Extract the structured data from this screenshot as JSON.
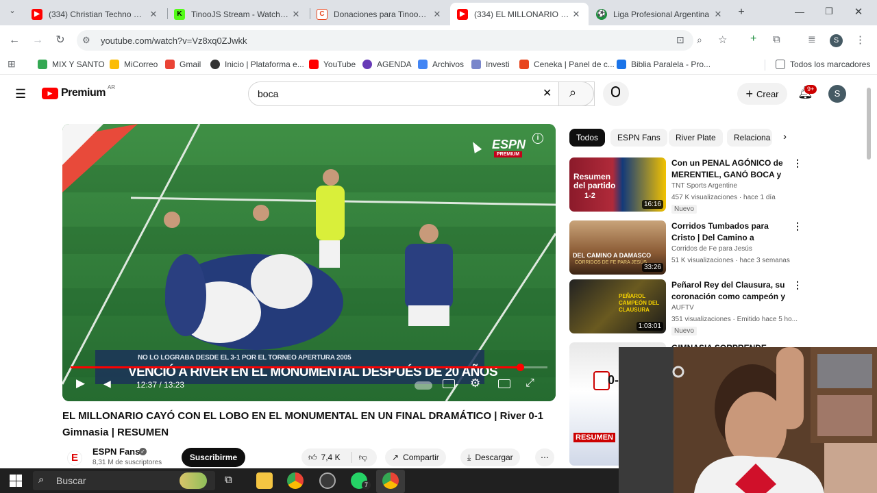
{
  "browser": {
    "tabs": [
      {
        "title": "(334) Christian Techno Musi",
        "favicon": "youtube-icon",
        "color": "#ff0000"
      },
      {
        "title": "TinooJS Stream - Watch Live",
        "favicon": "kick-icon",
        "color": "#53fc18"
      },
      {
        "title": "Donaciones para TinooKick",
        "favicon": "cafecito-icon",
        "color": "#e8461e"
      },
      {
        "title": "(334) EL MILLONARIO CAYÓ",
        "favicon": "youtube-icon",
        "color": "#ff0000"
      },
      {
        "title": "Liga Profesional Argentina",
        "favicon": "football-icon",
        "color": "#1e8e3e"
      }
    ],
    "url": "youtube.com/watch?v=Vz8xq0ZJwkk",
    "profile_initial": "S",
    "bookmarks": [
      {
        "label": "MIX Y SANTO",
        "color": "#34a853"
      },
      {
        "label": "MiCorreo",
        "color": "#fbbc04"
      },
      {
        "label": "Gmail",
        "color": "#ea4335"
      },
      {
        "label": "Inicio | Plataforma e...",
        "color": "#333333"
      },
      {
        "label": "YouTube",
        "color": "#ff0000"
      },
      {
        "label": "AGENDA",
        "color": "#673ab7"
      },
      {
        "label": "Archivos",
        "color": "#4285f4"
      },
      {
        "label": "Investi",
        "color": "#7986cb"
      },
      {
        "label": "Ceneka | Panel de c...",
        "color": "#e8461e"
      },
      {
        "label": "Biblia Paralela - Pro...",
        "color": "#1a73e8"
      }
    ],
    "all_bookmarks": "Todos los marcadores"
  },
  "youtube": {
    "logo": "Premium",
    "region": "AR",
    "search_value": "boca",
    "create_label": "Crear",
    "notifications": "9+",
    "avatar_initial": "S"
  },
  "video": {
    "caption_small": "NO LO LOGRABA DESDE EL 3-1 POR EL TORNEO APERTURA 2005",
    "caption_big": "VENCIÓ A RIVER EN EL MONUMENTAL DESPUÉS DE 20 AÑOS",
    "time": "12:37 / 13:23",
    "progress": 0.943,
    "watermark": "ESPN",
    "watermark_sub": "PREMIUM",
    "title": "EL MILLONARIO CAYÓ CON EL LOBO EN EL MONUMENTAL EN UN FINAL DRAMÁTICO | River 0-1 Gimnasia | RESUMEN",
    "channel": "ESPN Fans",
    "subscribers": "8,31 M de suscriptores",
    "subscribe_label": "Suscribirme",
    "likes": "7,4 K",
    "share_label": "Compartir",
    "download_label": "Descargar"
  },
  "chips": [
    "Todos",
    "ESPN Fans",
    "River Plate",
    "Relaciona"
  ],
  "suggestions": [
    {
      "title": "Con un PENAL AGÓNICO de MERENTIEL, GANÓ BOCA y ...",
      "channel": "TNT Sports Argentine",
      "meta": "457 K visualizaciones · hace 1 día",
      "duration": "16:16",
      "badge": "Nuevo",
      "thumb_text": "Resumen del partido",
      "thumb_score": "1-2"
    },
    {
      "title": "Corridos Tumbados para Cristo | Del Camino a Damasco ...",
      "channel": "Corridos de Fe para Jesús",
      "meta": "51 K visualizaciones · hace 3 semanas",
      "duration": "33:26",
      "badge": "",
      "thumb_text": "DEL CAMINO A DAMASCO",
      "thumb_score": "CORRIDOS DE FE PARA JESÚS"
    },
    {
      "title": "Peñarol Rey del Clausura, su coronación como campeón y ...",
      "channel": "AUFTV",
      "meta": "351 visualizaciones · Emitido hace 5 ho...",
      "duration": "1:03:01",
      "badge": "Nuevo",
      "thumb_text": "PEÑAROL CAMPEÓN DEL CLAUSURA",
      "thumb_score": ""
    },
    {
      "title": "GIMNASIA SORPRENDE...",
      "channel": "",
      "meta": "",
      "duration": "",
      "badge": "",
      "thumb_text": "RESUMEN",
      "thumb_score": "0-1"
    }
  ],
  "taskbar": {
    "search_placeholder": "Buscar",
    "whatsapp_count": "7"
  }
}
